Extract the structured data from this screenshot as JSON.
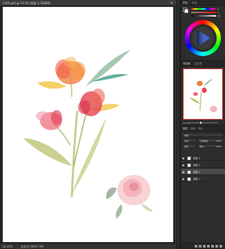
{
  "document": {
    "tab_title": "2305.psd @ 33.3% (图层 3, RGB/8)",
    "close_glyph": "×",
    "status_zoom": "33.33%",
    "status_info": "文档:8.3M/47.9M"
  },
  "color_panel": {
    "tab_color": "颜色",
    "tab_swatches": "色板",
    "h_value": "0",
    "s_value": "0",
    "b_value": "10"
  },
  "navigator_panel": {
    "tab_navigator": "导航器",
    "tab_histogram": "直方图",
    "zoom": "33.33%"
  },
  "layers_panel": {
    "tab_layers": "图层",
    "tab_channels": "通道",
    "tab_paths": "路径",
    "kind_label": "类型",
    "blend_mode": "正常",
    "opacity_label": "不透明度:",
    "opacity_value": "100%",
    "lock_label": "锁定:",
    "fill_label": "填充:",
    "fill_value": "100%",
    "eye_glyph": "●",
    "layers": [
      {
        "name": "图层 4",
        "active": false
      },
      {
        "name": "图层 3",
        "active": false
      },
      {
        "name": "图层 2",
        "active": true
      },
      {
        "name": "图层 1",
        "active": false
      }
    ]
  },
  "colors": {
    "accent_red": "#d33b3b",
    "panel_bg": "#2d2d2d"
  }
}
